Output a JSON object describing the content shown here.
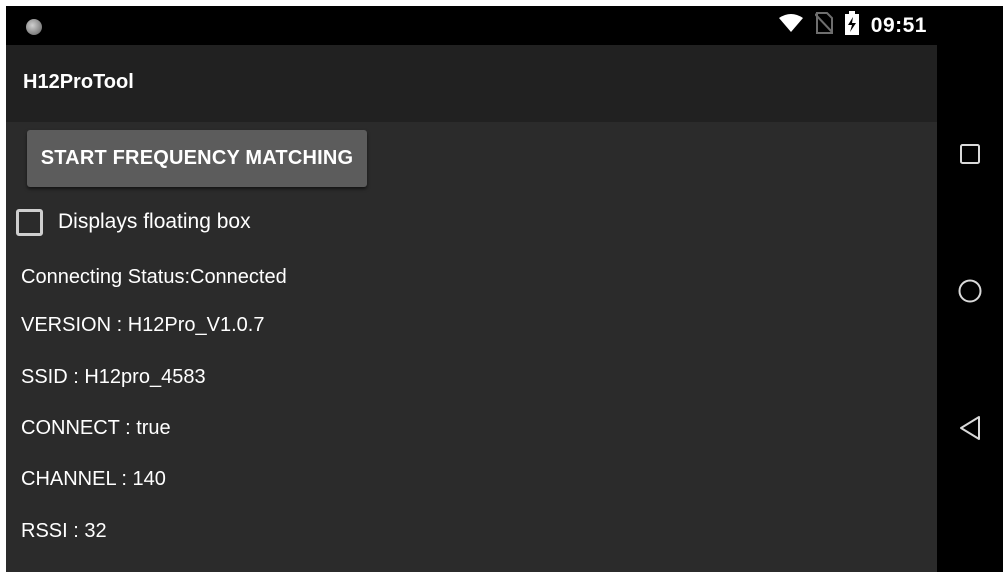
{
  "status_bar": {
    "time": "09:51",
    "icons": [
      "notification-dot-icon",
      "wifi-icon",
      "no-sim-icon",
      "battery-charging-icon"
    ]
  },
  "app_bar": {
    "title": "H12ProTool"
  },
  "actions": {
    "start_button_label": "START FREQUENCY MATCHING"
  },
  "options": {
    "floating_box_label": "Displays floating box",
    "floating_box_checked": false
  },
  "info": {
    "connecting_status": "Connecting Status:Connected",
    "version": "VERSION : H12Pro_V1.0.7",
    "ssid": "SSID : H12pro_4583",
    "connect": "CONNECT : true",
    "channel": "CHANNEL : 140",
    "rssi": "RSSI : 32"
  },
  "nav_bar": {
    "buttons": [
      "recents-icon",
      "home-icon",
      "back-icon"
    ]
  }
}
